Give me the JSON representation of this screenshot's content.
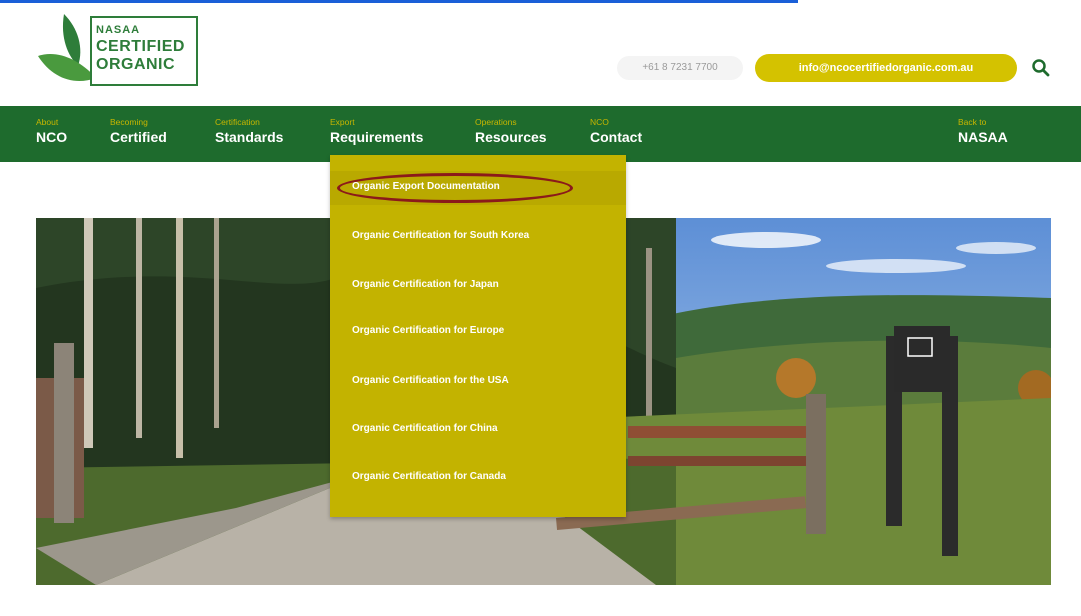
{
  "header": {
    "logo": {
      "small": "NASAA",
      "line1": "CERTIFIED",
      "line2": "ORGANIC"
    },
    "phone": "+61 8 7231 7700",
    "email": "info@ncocertifiedorganic.com.au",
    "search_icon": "search-icon"
  },
  "nav": {
    "items": [
      {
        "sub": "About",
        "main": "NCO"
      },
      {
        "sub": "Becoming",
        "main": "Certified"
      },
      {
        "sub": "Certification",
        "main": "Standards"
      },
      {
        "sub": "Export",
        "main": "Requirements"
      },
      {
        "sub": "Operations",
        "main": "Resources"
      },
      {
        "sub": "NCO",
        "main": "Contact"
      },
      {
        "sub": "Back to",
        "main": "NASAA"
      }
    ]
  },
  "dropdown": {
    "items": [
      "Organic Export Documentation",
      "Organic Certification for South Korea",
      "Organic Certification for Japan",
      "Organic Certification for Europe",
      "Organic Certification for the USA",
      "Organic Certification for China",
      "Organic Certification for Canada"
    ],
    "highlight_color": "#8b1a1a"
  },
  "colors": {
    "nav_bg": "#1e6b2d",
    "accent": "#c3b300",
    "brand_green": "#2e7d3a"
  }
}
